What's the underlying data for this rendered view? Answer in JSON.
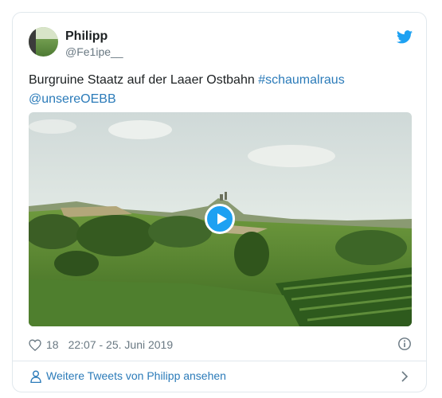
{
  "tweet": {
    "author": {
      "name": "Philipp",
      "handle": "@Fe1ipe__",
      "avatar_icon": "avatar-landscape"
    },
    "brand_icon": "twitter-bird-icon",
    "colors": {
      "brand": "#1da1f2",
      "link": "#2b7bb9",
      "text": "#1c2022",
      "muted": "#697882",
      "border": "#e1e8ed"
    },
    "text": {
      "main": "Burgruine Staatz auf der Laaer Ostbahn",
      "hashtag": "#schaumalraus",
      "mention": "@unsereOEBB"
    },
    "media": {
      "type": "video",
      "play_icon": "play-icon",
      "scene": "train window view of green fields, vineyard and castle ruin hill"
    },
    "likes": "18",
    "timestamp": "22:07 - 25. Juni 2019",
    "info_icon": "info-icon",
    "more_link": {
      "label": "Weitere Tweets von Philipp ansehen",
      "icon": "person-icon",
      "chevron": "chevron-right-icon"
    }
  }
}
